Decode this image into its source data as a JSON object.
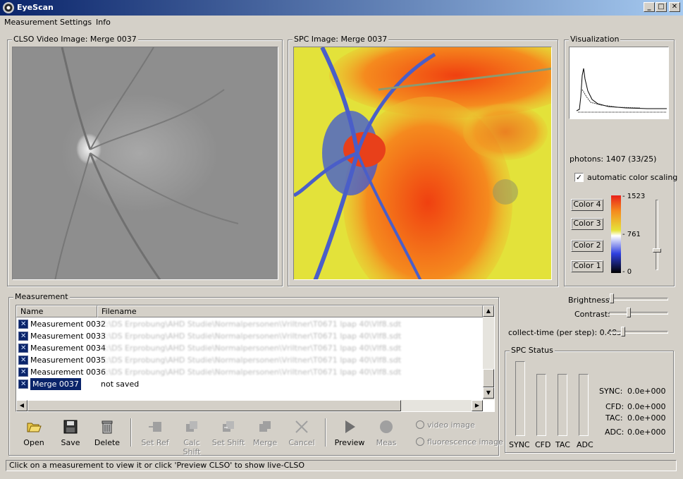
{
  "window": {
    "title": "EyeScan"
  },
  "menu": [
    "Measurement",
    "Settings",
    "Info"
  ],
  "panels": {
    "clso_title": "CLSO Video Image: Merge 0037",
    "spc_title": "SPC Image: Merge 0037",
    "viz_title": "Visualization",
    "measurement_title": "Measurement",
    "spc_status_title": "SPC Status"
  },
  "visualization": {
    "photons": "photons: 1407 (33/25)",
    "auto_scaling_label": "automatic color scaling",
    "auto_scaling_checked": true,
    "color_buttons": [
      "Color 4",
      "Color 3",
      "Color 2",
      "Color 1"
    ],
    "scale_labels": {
      "max": "1523",
      "mid": "761",
      "min": "0"
    }
  },
  "adjust": {
    "brightness_label": "Brightness:",
    "contrast_label": "Contrast:",
    "collect_label": "collect-time (per step): 0.48s"
  },
  "list": {
    "columns": [
      "Name",
      "Filename"
    ],
    "rows": [
      {
        "name": "Measurement 0032",
        "file": "C:\\DS Erprobung\\AHD Studie\\Normalpersonen\\Vriltner\\T0671 lpap 40\\Vlf8.sdt"
      },
      {
        "name": "Measurement 0033",
        "file": "C:\\DS Erprobung\\AHD Studie\\Normalpersonen\\Vriltner\\T0671 lpap 40\\Vlf8.sdt"
      },
      {
        "name": "Measurement 0034",
        "file": "C:\\DS Erprobung\\AHD Studie\\Normalpersonen\\Vriltner\\T0671 lpap 40\\Vlf8.sdt"
      },
      {
        "name": "Measurement 0035",
        "file": "C:\\DS Erprobung\\AHD Studie\\Normalpersonen\\Vriltner\\T0671 lpap 40\\Vlf8.sdt"
      },
      {
        "name": "Measurement 0036",
        "file": "C:\\DS Erprobung\\AHD Studie\\Normalpersonen\\Vriltner\\T0671 lpap 40\\Vlf8.sdt"
      },
      {
        "name": "Merge 0037",
        "file": "not saved"
      }
    ]
  },
  "toolbar": {
    "open": "Open",
    "save": "Save",
    "delete": "Delete",
    "set_ref": "Set Ref",
    "calc_shift": "Calc Shift",
    "set_shift": "Set Shift",
    "merge": "Merge",
    "cancel": "Cancel",
    "preview": "Preview",
    "meas": "Meas",
    "video_image": "video image",
    "fluorescence_image": "fluorescence image"
  },
  "spc_status": {
    "bars": [
      "SYNC",
      "CFD",
      "TAC",
      "ADC"
    ],
    "readouts": [
      {
        "label": "SYNC:",
        "value": "0.0e+000"
      },
      {
        "label": "CFD:",
        "value": "0.0e+000"
      },
      {
        "label": "TAC:",
        "value": "0.0e+000"
      },
      {
        "label": "ADC:",
        "value": "0.0e+000"
      }
    ]
  },
  "statusbar": "Click on a measurement to view it or click 'Preview CLSO' to show live-CLSO",
  "colors": {
    "titlebar_start": "#0a246a",
    "titlebar_end": "#a6caf0",
    "selection": "#0a246a",
    "face": "#d4d0c8"
  }
}
